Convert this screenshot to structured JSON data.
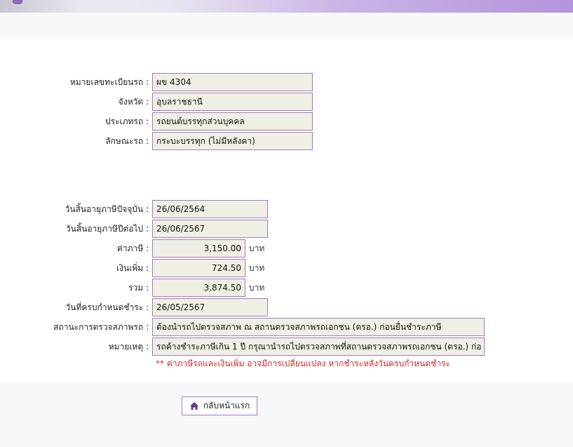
{
  "colors": {
    "field_bg": "#efefe3",
    "field_border": "#a07cc4",
    "note_red": "#d12a2a",
    "header_purple": "#b493dc"
  },
  "vehicle": {
    "plate_label": "หมายเลขทะเบียนรถ :",
    "plate_value": "ผข 4304",
    "province_label": "จังหวัด :",
    "province_value": "อุบลราชธานี",
    "type_label": "ประเภทรถ :",
    "type_value": "รถยนต์บรรทุกส่วนบุคคล",
    "style_label": "ลักษณะรถ :",
    "style_value": "กระบะบรรทุก (ไม่มีหลังคา)"
  },
  "tax": {
    "current_expiry_label": "วันสิ้นอายุภาษีปัจจุบัน :",
    "current_expiry_value": "26/06/2564",
    "next_expiry_label": "วันสิ้นอายุภาษีปีต่อไป :",
    "next_expiry_value": "26/06/2567",
    "tax_label": "ค่าภาษี :",
    "tax_value": "3,150.00",
    "penalty_label": "เงินเพิ่ม :",
    "penalty_value": "724.50",
    "total_label": "รวม :",
    "total_value": "3,874.50",
    "unit": "บาท",
    "due_label": "วันที่ครบกำหนดชำระ :",
    "due_value": "26/05/2567",
    "inspection_label": "สถานะการตรวจสภาพรถ :",
    "inspection_value": "ต้องนำรถไปตรวจสภาพ ณ สถานตรวจสภาพรถเอกชน (ตรอ.) ก่อนยื่นชำระภาษี",
    "remark_label": "หมายเหตุ :",
    "remark_value": "รถค้างชำระภาษีเกิน 1 ปี กรุณานำรถไปตรวจสภาพที่สถานตรวจสภาพรถเอกชน (ตรอ.) ก่อ"
  },
  "note": "** ค่าภาษีรถและเงินเพิ่ม อาจมีการเปลี่ยนแปลง หากชำระหลังวันครบกำหนดชำระ",
  "home_button": {
    "label": "กลับหน้าแรก",
    "icon": "home-icon"
  }
}
